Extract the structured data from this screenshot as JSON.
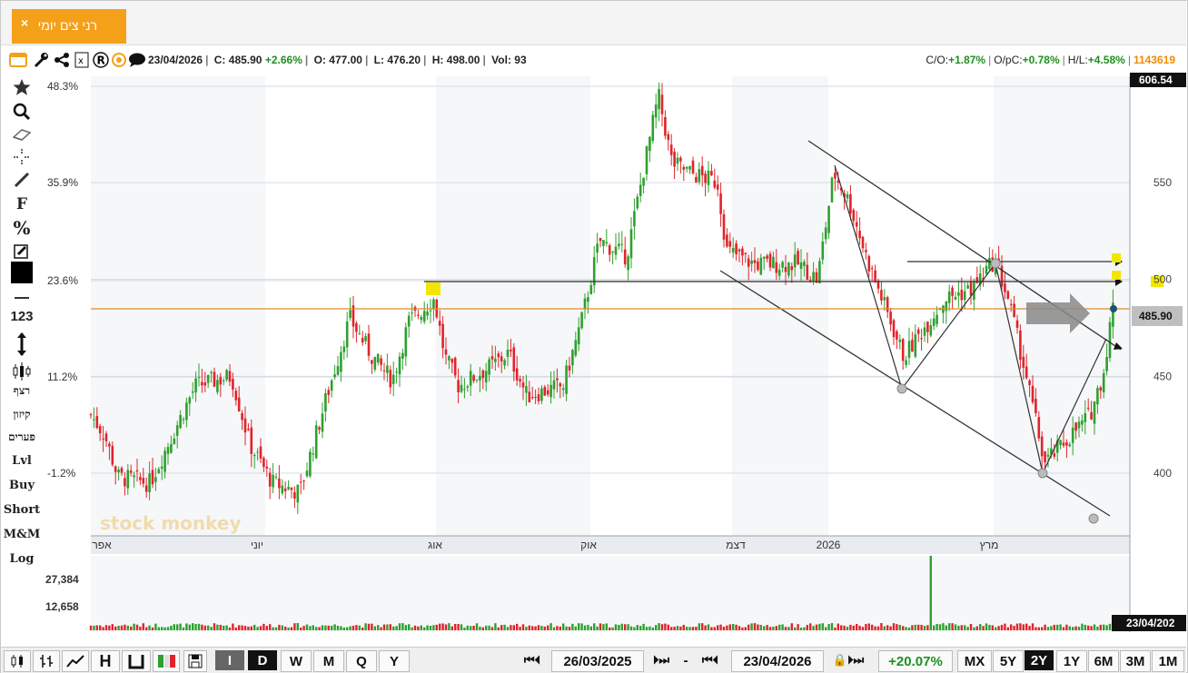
{
  "tab": {
    "title": "רני צים יומי",
    "close": "×"
  },
  "info": {
    "date": "23/04/2026",
    "close_label": "C:",
    "close": "485.90",
    "change": "+2.66%",
    "open_label": "O:",
    "open": "477.00",
    "low_label": "L:",
    "low": "476.20",
    "high_label": "H:",
    "high": "498.00",
    "vol_label": "Vol:",
    "vol": "93",
    "co_label": "C/O:",
    "co": "+1.87%",
    "opc_label": "O/pC:",
    "opc": "+0.78%",
    "hl_label": "H/L:",
    "hl": "+4.58%",
    "id": "1143619"
  },
  "toolbar_icons": [
    "window-icon",
    "wrench-icon",
    "share-icon",
    "excel-icon",
    "registered-icon",
    "circle-target-icon",
    "comment-icon"
  ],
  "left_tools": {
    "items": [
      "star-icon",
      "search-icon",
      "eraser-icon",
      "crosshair-icon",
      "line-icon"
    ],
    "f": "F",
    "percent": "%",
    "num": "123",
    "cluster": "רצף",
    "kizun": "קיזון",
    "paarim": "פערים",
    "lvl": "Lvl",
    "buy": "Buy",
    "short": "Short",
    "mm": "M&M",
    "log": "Log"
  },
  "colors": {
    "up": "#2ea02e",
    "down": "#e0242a",
    "accent": "#f5a019",
    "price_line": "#e08a2a",
    "marker": "#f2e600"
  },
  "chart_data": {
    "type": "candlestick",
    "y_right_ticks": [
      400,
      450,
      500,
      550
    ],
    "y_left_ticks": [
      "48.3%",
      "35.9%",
      "23.6%",
      "11.2%",
      "-1.2%"
    ],
    "x_ticks": [
      "אפר",
      "יוני",
      "אוג",
      "אוק",
      "דצמ",
      "2026",
      "מרץ"
    ],
    "last_price": "485.90",
    "top_label": "606.54",
    "last_date_label": "23/04/202",
    "volume_ticks": [
      "27,384",
      "12,658"
    ],
    "watermark": "stock monkey",
    "horizontal_level": 500,
    "price_line": 486,
    "ylim": [
      380,
      612
    ]
  },
  "bottom": {
    "range_start": "26/03/2025",
    "range_dash": "-",
    "range_end": "23/04/2026",
    "range_change": "+20.07%",
    "intervals": [
      "I",
      "D",
      "W",
      "M",
      "Q",
      "Y"
    ],
    "periods": [
      "MX",
      "5Y",
      "2Y",
      "1Y",
      "6M",
      "3M",
      "1M"
    ],
    "selected_period": "2Y",
    "selected_interval": "D"
  }
}
